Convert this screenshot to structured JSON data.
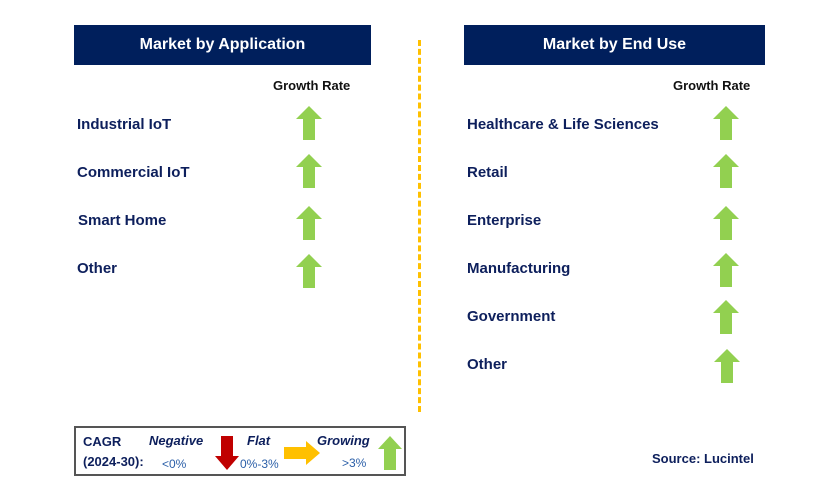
{
  "left_panel": {
    "title": "Market by Application",
    "column_header": "Growth Rate",
    "items": [
      {
        "label": "Industrial IoT",
        "trend": "growing"
      },
      {
        "label": "Commercial IoT",
        "trend": "growing"
      },
      {
        "label": "Smart Home",
        "trend": "growing"
      },
      {
        "label": "Other",
        "trend": "growing"
      }
    ]
  },
  "right_panel": {
    "title": "Market by End Use",
    "column_header": "Growth Rate",
    "items": [
      {
        "label": "Healthcare & Life Sciences",
        "trend": "growing"
      },
      {
        "label": "Retail",
        "trend": "growing"
      },
      {
        "label": "Enterprise",
        "trend": "growing"
      },
      {
        "label": "Manufacturing",
        "trend": "growing"
      },
      {
        "label": "Government",
        "trend": "growing"
      },
      {
        "label": "Other",
        "trend": "growing"
      }
    ]
  },
  "legend": {
    "cagr_label": "CAGR",
    "period_label": "(2024-30):",
    "negative": {
      "label": "Negative",
      "range": "<0%",
      "icon": "arrow-down-icon",
      "color": "#c00000"
    },
    "flat": {
      "label": "Flat",
      "range": "0%-3%",
      "icon": "arrow-right-icon",
      "color": "#ffc000"
    },
    "growing": {
      "label": "Growing",
      "range": ">3%",
      "icon": "arrow-up-icon",
      "color": "#92d050"
    }
  },
  "source": "Source: Lucintel",
  "colors": {
    "header_bg": "#001f5c",
    "divider": "#ffc000",
    "text": "#0d1f5c"
  }
}
